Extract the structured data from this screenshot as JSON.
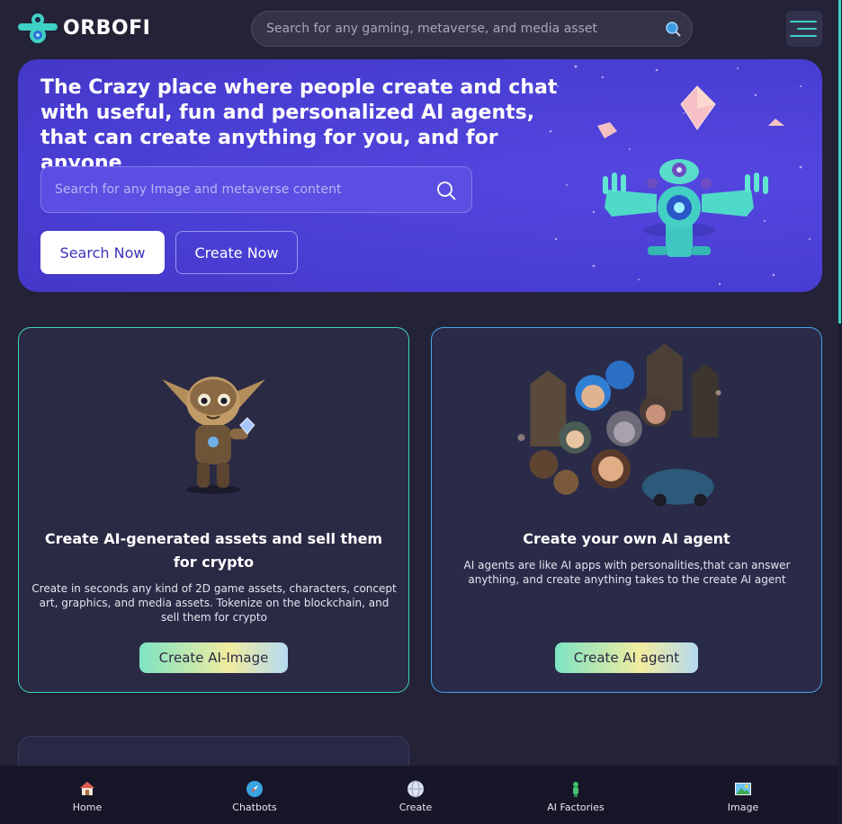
{
  "header": {
    "logo_text": "ORBOFI",
    "search_placeholder": "Search for any gaming, metaverse, and media asset",
    "search_icon": "search-icon",
    "menu_icon": "hamburger-menu-icon"
  },
  "hero": {
    "title": "The Crazy place where people create and chat with useful, fun and personalized AI agents, that can create anything for you, and for anyone",
    "search_placeholder": "Search for any Image and metaverse content",
    "search_now_label": "Search Now",
    "create_now_label": "Create Now"
  },
  "cards": [
    {
      "title": "Create AI-generated assets and sell them for crypto",
      "description": "Create in seconds any kind of 2D game assets, characters, concept art, graphics, and media assets. Tokenize on the blockchain, and sell them for crypto",
      "button_label": "Create AI-Image"
    },
    {
      "title": "Create your own AI agent",
      "description": "AI agents are like AI apps with personalities,that can answer anything, and create anything takes to the create AI agent",
      "button_label": "Create AI agent"
    }
  ],
  "bottom_nav": [
    {
      "label": "Home",
      "icon": "home-icon"
    },
    {
      "label": "Chatbots",
      "icon": "compass-icon"
    },
    {
      "label": "Create",
      "icon": "globe-icon"
    },
    {
      "label": "AI Factories",
      "icon": "robot-icon"
    },
    {
      "label": "Image",
      "icon": "image-icon"
    }
  ],
  "colors": {
    "background": "#232237",
    "hero": "#4a3fd4",
    "accent_teal": "#3fd1c6",
    "card_border_green": "#3bd6b3",
    "card_border_blue": "#46a6e6"
  }
}
